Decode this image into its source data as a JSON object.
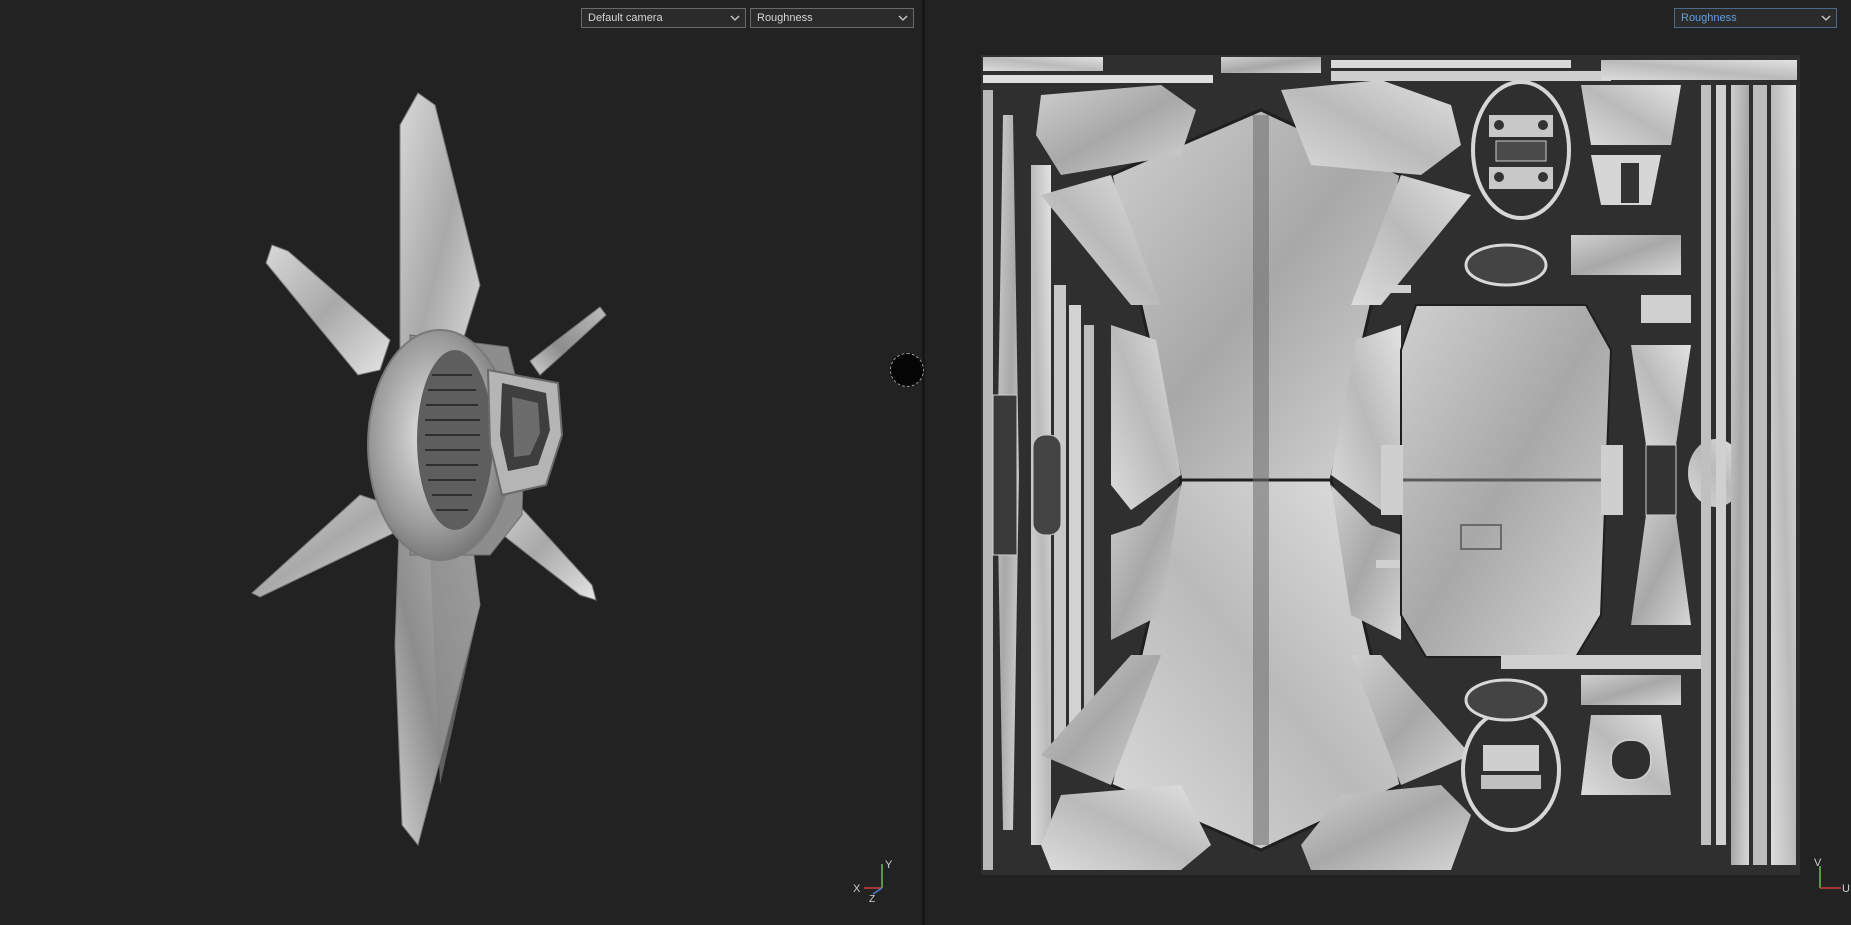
{
  "left_viewport": {
    "camera_select": {
      "value": "Default camera"
    },
    "channel_select": {
      "value": "Roughness"
    },
    "axis_gizmo": {
      "x": "X",
      "y": "Y",
      "z": "Z"
    }
  },
  "right_viewport": {
    "channel_select": {
      "value": "Roughness"
    },
    "axis_gizmo": {
      "v": "V",
      "u": "U"
    }
  },
  "colors": {
    "background": "#222222",
    "accent": "#5fa0e0",
    "axis_y": "#6bbf4a",
    "axis_x": "#d04040",
    "axis_z": "#4a7ad0"
  },
  "icons": [
    "chevron-down-icon",
    "axis-gizmo-icon",
    "split-handle-icon"
  ]
}
